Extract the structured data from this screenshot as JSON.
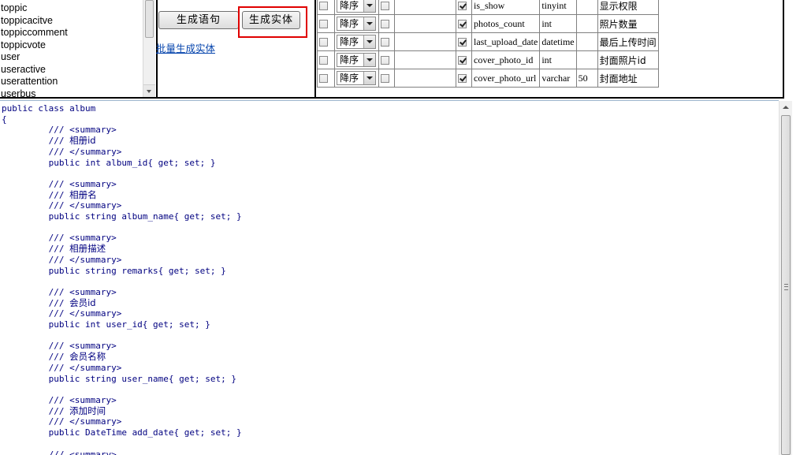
{
  "table_list": {
    "items": [
      "toppic",
      "toppicacitve",
      "toppiccomment",
      "toppicvote",
      "user",
      "useractive",
      "userattention",
      "userbus"
    ]
  },
  "actions": {
    "generate_sql_label": "生成语句",
    "generate_entity_label": "生成实体",
    "batch_link_label": "批量生成实体"
  },
  "columns": [
    {
      "sort": "降序",
      "pk": false,
      "selected": true,
      "name": "is_show",
      "type": "tinyint",
      "length": "",
      "comment": "显示权限"
    },
    {
      "sort": "降序",
      "pk": false,
      "selected": true,
      "name": "photos_count",
      "type": "int",
      "length": "",
      "comment": "照片数量"
    },
    {
      "sort": "降序",
      "pk": false,
      "selected": true,
      "name": "last_upload_date",
      "type": "datetime",
      "length": "",
      "comment": "最后上传时间"
    },
    {
      "sort": "降序",
      "pk": false,
      "selected": true,
      "name": "cover_photo_id",
      "type": "int",
      "length": "",
      "comment": "封面照片id"
    },
    {
      "sort": "降序",
      "pk": false,
      "selected": true,
      "name": "cover_photo_url",
      "type": "varchar",
      "length": "50",
      "comment": "封面地址"
    }
  ],
  "code": {
    "header": "public class album",
    "open_brace": "{",
    "summary_open": "/// <summary>",
    "summary_close": "/// </summary>",
    "comment_prefix": "/// ",
    "properties": [
      {
        "comment": "相册id",
        "decl": "public int album_id{ get; set; }"
      },
      {
        "comment": "相册名",
        "decl": "public string album_name{ get; set; }"
      },
      {
        "comment": "相册描述",
        "decl": "public string remarks{ get; set; }"
      },
      {
        "comment": "会员id",
        "decl": "public int user_id{ get; set; }"
      },
      {
        "comment": "会员名称",
        "decl": "public string user_name{ get; set; }"
      },
      {
        "comment": "添加时间",
        "decl": "public DateTime add_date{ get; set; }"
      }
    ],
    "trailing": "/// <summary>"
  }
}
